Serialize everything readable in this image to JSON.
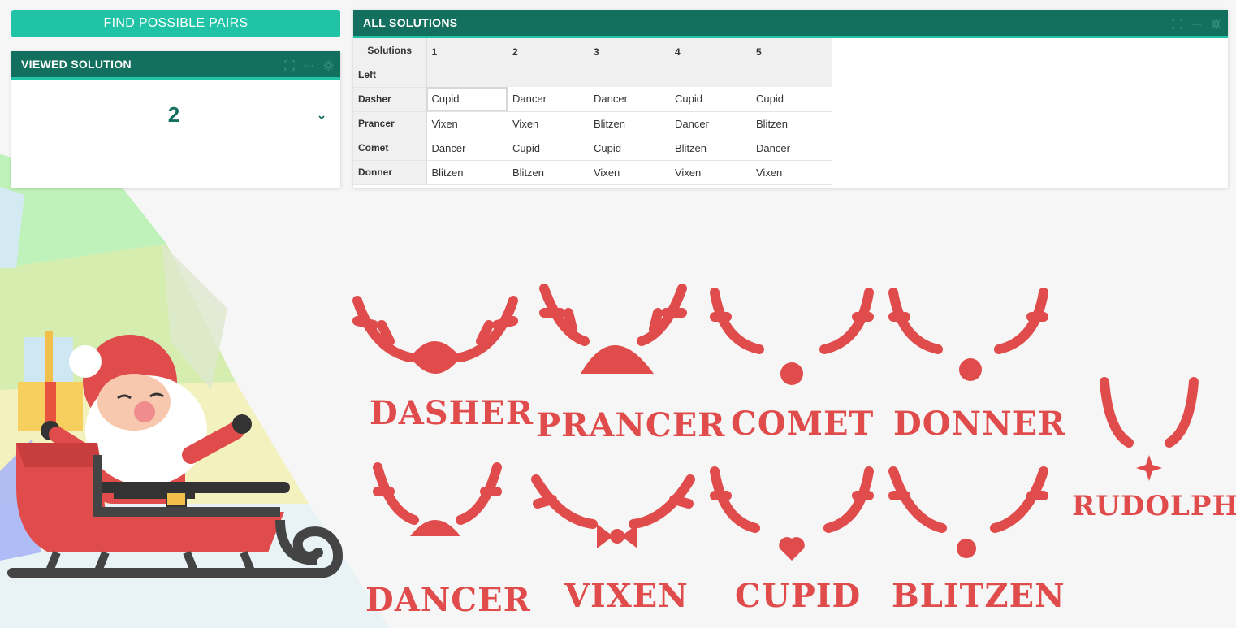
{
  "buttons": {
    "find_pairs": "FIND POSSIBLE PAIRS"
  },
  "viewed_solution": {
    "title": "VIEWED SOLUTION",
    "value": "2"
  },
  "all_solutions": {
    "title": "ALL SOLUTIONS",
    "corner_label": "Solutions",
    "left_label": "Left",
    "columns": [
      "1",
      "2",
      "3",
      "4",
      "5"
    ],
    "rows": [
      {
        "name": "Dasher",
        "cells": [
          "Cupid",
          "Dancer",
          "Dancer",
          "Cupid",
          "Cupid"
        ]
      },
      {
        "name": "Prancer",
        "cells": [
          "Vixen",
          "Vixen",
          "Blitzen",
          "Dancer",
          "Blitzen"
        ]
      },
      {
        "name": "Comet",
        "cells": [
          "Dancer",
          "Cupid",
          "Cupid",
          "Blitzen",
          "Dancer"
        ]
      },
      {
        "name": "Donner",
        "cells": [
          "Blitzen",
          "Blitzen",
          "Vixen",
          "Vixen",
          "Vixen"
        ]
      }
    ]
  },
  "reindeer": [
    "DASHER",
    "PRANCER",
    "COMET",
    "DONNER",
    "DANCER",
    "VIXEN",
    "CUPID",
    "BLITZEN",
    "RUDOLPH"
  ],
  "colors": {
    "header": "#14705e",
    "accent": "#20c3a5",
    "reindeer_red": "#e04b4b"
  },
  "icons": [
    "expand-icon",
    "more-icon",
    "gear-icon",
    "chevron-down-icon",
    "santa-sleigh-illustration"
  ]
}
